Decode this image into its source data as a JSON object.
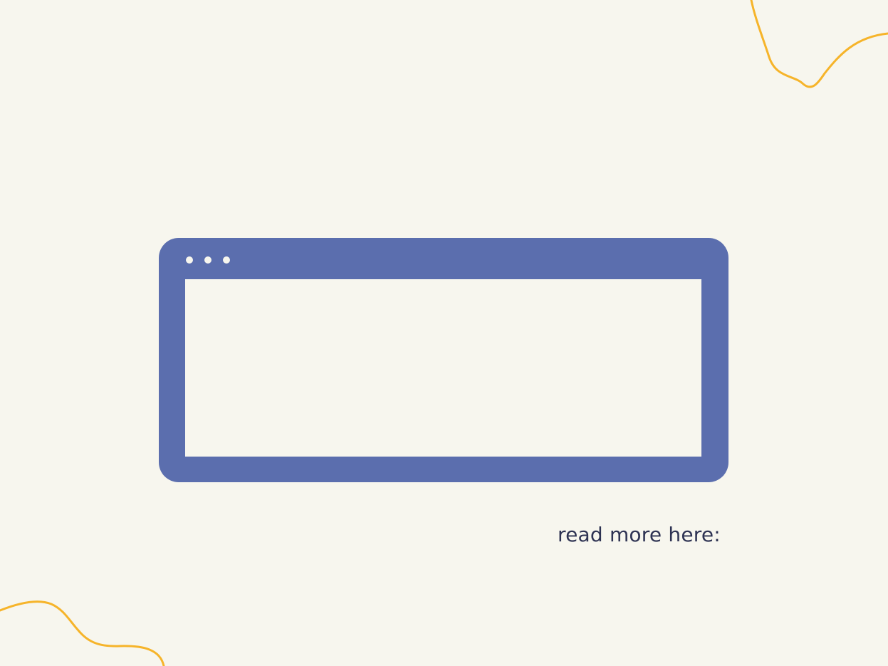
{
  "page": {
    "background_color": "#f7f6ee"
  },
  "browser_mockup": {
    "frame_color": "#5b6eae",
    "viewport_color": "#f7f6ee",
    "dot_color": "#f7f6ee",
    "window_dots": [
      "dot",
      "dot",
      "dot"
    ]
  },
  "caption": {
    "text": "read more here:",
    "color": "#2d3252"
  },
  "decorations": {
    "squiggle_color": "#f6b42a",
    "items": [
      "top-right-squiggle",
      "bottom-left-squiggle"
    ]
  }
}
